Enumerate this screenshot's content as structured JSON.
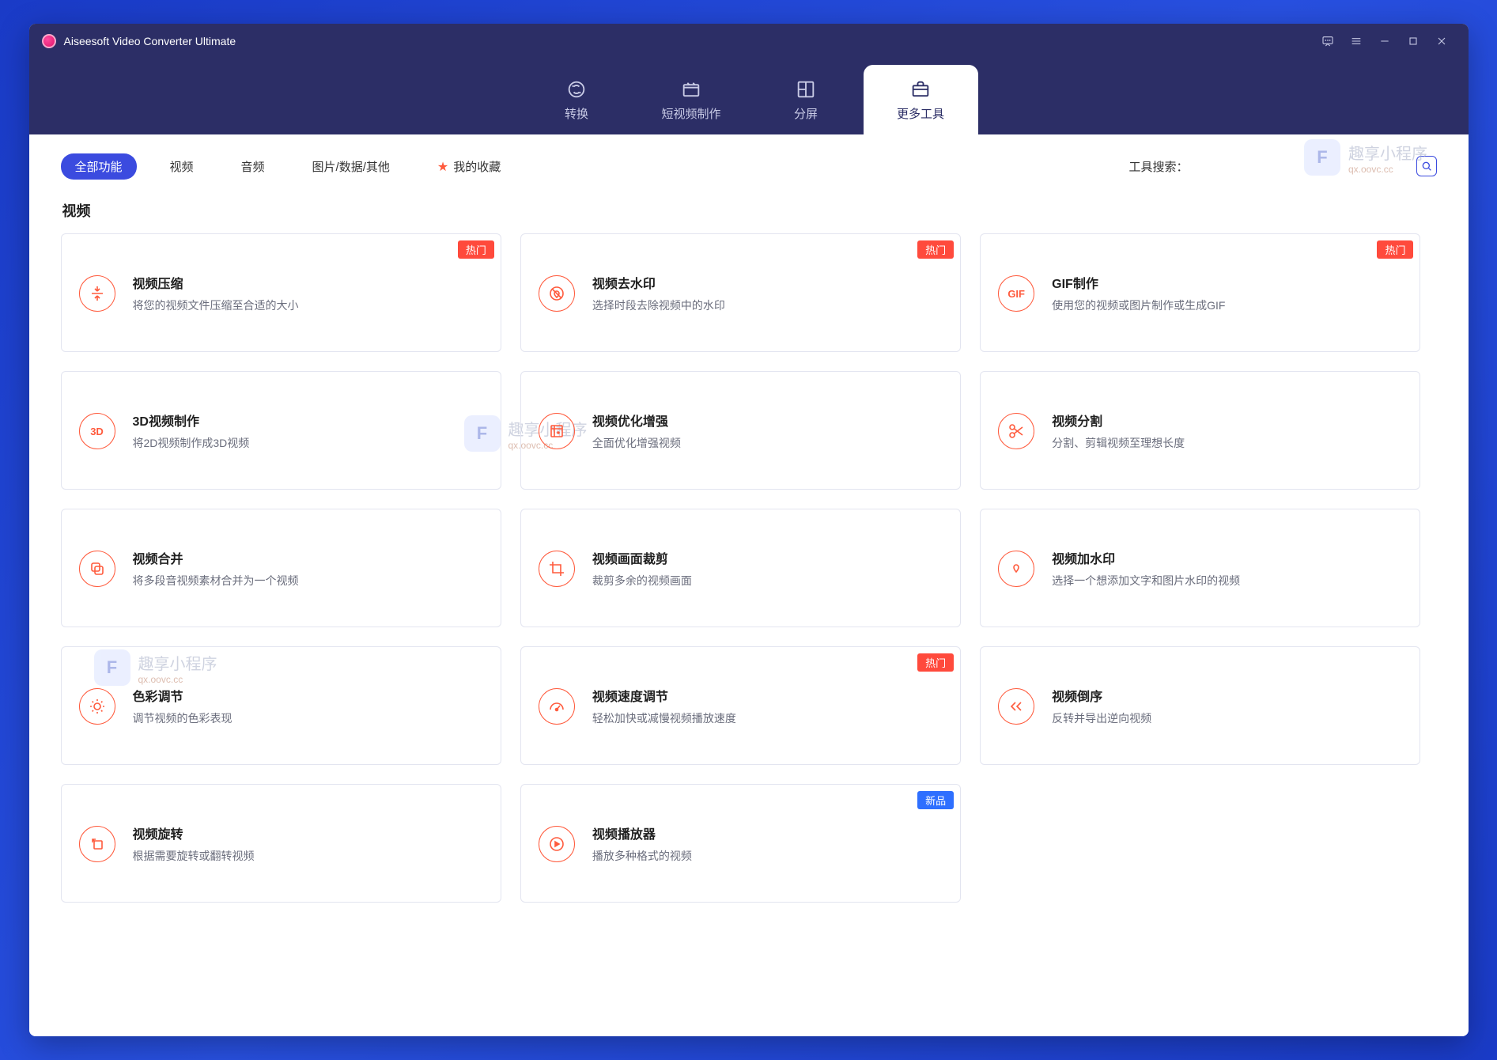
{
  "app": {
    "title": "Aiseesoft Video Converter Ultimate"
  },
  "nav": {
    "items": [
      {
        "label": "转换"
      },
      {
        "label": "短视频制作"
      },
      {
        "label": "分屏"
      },
      {
        "label": "更多工具"
      }
    ]
  },
  "filters": {
    "items": [
      {
        "label": "全部功能"
      },
      {
        "label": "视频"
      },
      {
        "label": "音频"
      },
      {
        "label": "图片/数据/其他"
      },
      {
        "label": "我的收藏"
      }
    ],
    "search_label": "工具搜索：",
    "search_placeholder": ""
  },
  "section": {
    "title": "视频"
  },
  "badges": {
    "hot": "热门",
    "new": "新品"
  },
  "cards": [
    {
      "title": "视频压缩",
      "desc": "将您的视频文件压缩至合适的大小",
      "badge": "hot",
      "icon": "compress"
    },
    {
      "title": "视频去水印",
      "desc": "选择时段去除视频中的水印",
      "badge": "hot",
      "icon": "nowm"
    },
    {
      "title": "GIF制作",
      "desc": "使用您的视频或图片制作或生成GIF",
      "badge": "hot",
      "icon": "gif"
    },
    {
      "title": "3D视频制作",
      "desc": "将2D视频制作成3D视频",
      "badge": null,
      "icon": "3d"
    },
    {
      "title": "视频优化增强",
      "desc": "全面优化增强视频",
      "badge": null,
      "icon": "enhance"
    },
    {
      "title": "视频分割",
      "desc": "分割、剪辑视频至理想长度",
      "badge": null,
      "icon": "cut"
    },
    {
      "title": "视频合并",
      "desc": "将多段音视频素材合并为一个视频",
      "badge": null,
      "icon": "merge"
    },
    {
      "title": "视频画面裁剪",
      "desc": "裁剪多余的视频画面",
      "badge": null,
      "icon": "crop"
    },
    {
      "title": "视频加水印",
      "desc": "选择一个想添加文字和图片水印的视频",
      "badge": null,
      "icon": "addwm"
    },
    {
      "title": "色彩调节",
      "desc": "调节视频的色彩表现",
      "badge": null,
      "icon": "color"
    },
    {
      "title": "视频速度调节",
      "desc": "轻松加快或减慢视频播放速度",
      "badge": "hot",
      "icon": "speed"
    },
    {
      "title": "视频倒序",
      "desc": "反转并导出逆向视频",
      "badge": null,
      "icon": "reverse"
    },
    {
      "title": "视频旋转",
      "desc": "根据需要旋转或翻转视频",
      "badge": null,
      "icon": "rotate"
    },
    {
      "title": "视频播放器",
      "desc": "播放多种格式的视频",
      "badge": "new",
      "icon": "play"
    }
  ],
  "watermark": {
    "badge": "F",
    "title": "趣享小程序",
    "sub": "qx.oovc.cc"
  }
}
